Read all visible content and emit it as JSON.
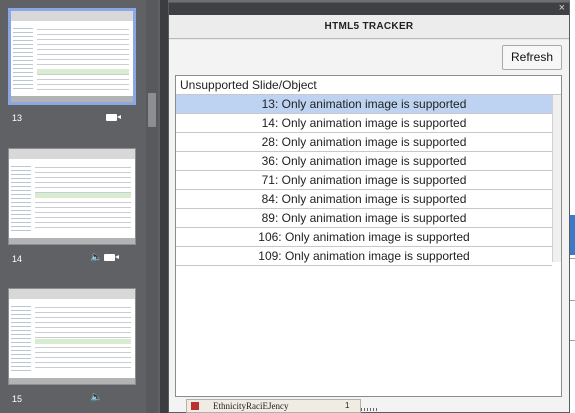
{
  "filmstrip": {
    "slides": [
      {
        "number": "13",
        "icons": [
          "video-icon"
        ]
      },
      {
        "number": "14",
        "icons": [
          "speaker-icon",
          "video-icon"
        ]
      },
      {
        "number": "15",
        "icons": [
          "speaker-icon"
        ]
      }
    ]
  },
  "panel": {
    "title": "HTML5 TRACKER",
    "close_glyph": "×",
    "refresh_label": "Refresh",
    "column_header": "Unsupported Slide/Object",
    "rows": [
      "13: Only animation image is supported",
      "14: Only animation image is supported",
      "28: Only animation image is supported",
      "36: Only animation image is supported",
      "71: Only animation image is supported",
      "84: Only animation image is supported",
      "89: Only animation image is supported",
      "106: Only animation image is supported",
      "109: Only animation image is supported"
    ]
  },
  "bottom_strip": {
    "text": "EthnicityRaciEJency",
    "number": "1"
  },
  "colors": {
    "selected_row": "#bdd3f1",
    "selected_slide_border": "#8aa6e4"
  }
}
